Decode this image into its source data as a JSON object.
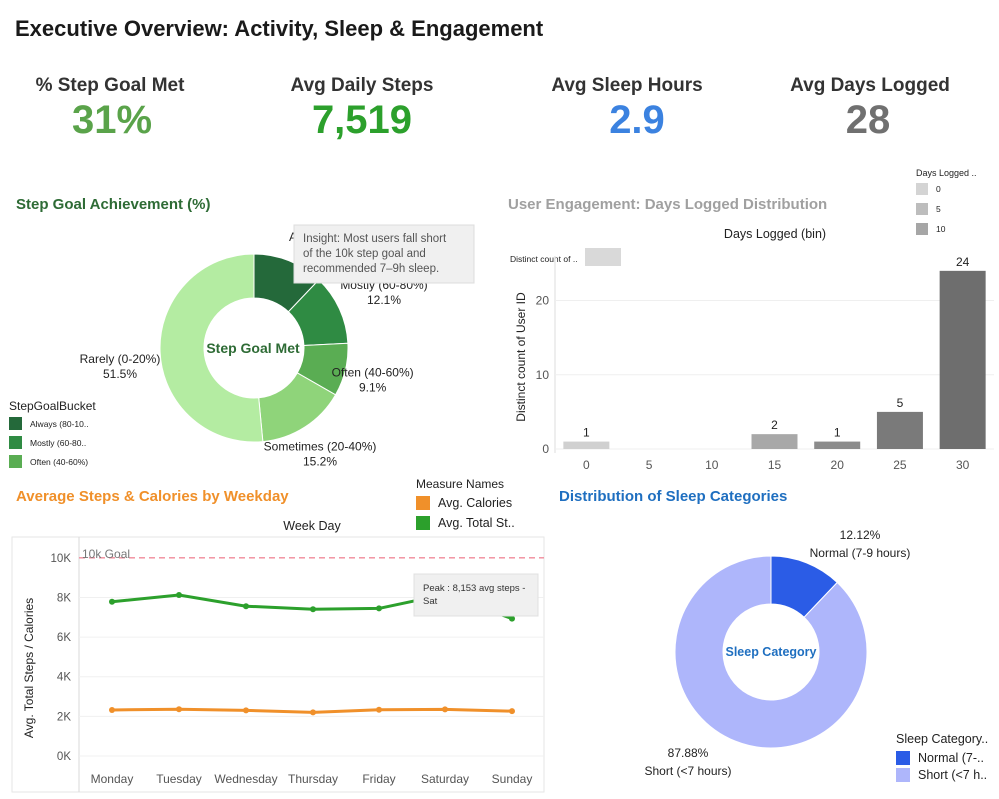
{
  "title": "Executive Overview: Activity, Sleep & Engagement",
  "kpis": [
    {
      "label": "% Step Goal Met",
      "value": "31%",
      "color": "#5aa34a"
    },
    {
      "label": "Avg Daily Steps",
      "value": "7,519",
      "color": "#2ca02c"
    },
    {
      "label": "Avg Sleep Hours",
      "value": "2.9",
      "color": "#3b82e0"
    },
    {
      "label": "Avg Days Logged",
      "value": "28",
      "color": "#707070"
    }
  ],
  "colors": {
    "green_title": "#2e6b35",
    "orange_title": "#f0902a",
    "blue_title": "#1f6fc0",
    "grey_title": "#a0a0a0"
  },
  "step_goal": {
    "title": "Step Goal Achievement (%)",
    "center_label": "Step Goal Met",
    "insight": "Insight: Most users fall short of the 10k step goal and recommended 7–9h sleep.",
    "hidden_label": "A",
    "legend_title": "StepGoalBucket",
    "legend_items": [
      {
        "label": "Always (80-10..",
        "color": "#24693a"
      },
      {
        "label": "Mostly (60-80..",
        "color": "#2f8b43"
      },
      {
        "label": "Often (40-60%)",
        "color": "#5aad53"
      }
    ]
  },
  "engagement": {
    "title": "User Engagement: Days Logged Distribution",
    "x_title": "Days Logged (bin)",
    "y_title": "Distinct count of User ID",
    "measure_chip": "Distinct count of ..",
    "legend_title": "Days Logged ..",
    "legend_items": [
      {
        "label": "0",
        "color": "#d4d4d4"
      },
      {
        "label": "5",
        "color": "#bdbdbd"
      },
      {
        "label": "10",
        "color": "#a6a6a6"
      }
    ]
  },
  "weekday": {
    "title": "Average Steps & Calories by Weekday",
    "header": "Week Day",
    "y_title": "Avg. Total Steps / Calories",
    "goal_label": "10k Goal",
    "peak_note": "Peak : 8,153 avg steps - Sat",
    "legend_title": "Measure Names",
    "legend_items": [
      {
        "label": "Avg. Calories",
        "color": "#f0902a"
      },
      {
        "label": "Avg. Total St..",
        "color": "#2ca02c"
      }
    ]
  },
  "sleep": {
    "title": "Distribution of Sleep Categories",
    "center_label": "Sleep Category",
    "legend_title": "Sleep Category..",
    "legend_items": [
      {
        "label": "Normal (7-..",
        "color": "#2b5ce6"
      },
      {
        "label": "Short (<7 h..",
        "color": "#aeb6fb"
      }
    ]
  },
  "chart_data": [
    {
      "type": "pie",
      "title": "Step Goal Achievement (%)",
      "labels": [
        "Always (80-100%)",
        "Mostly (60-80%)",
        "Often (40-60%)",
        "Sometimes (20-40%)",
        "Rarely (0-20%)"
      ],
      "display_labels": [
        "",
        "Mostly (60-80%)",
        "Often (40-60%)",
        "Sometimes (20-40%)",
        "Rarely (0-20%)"
      ],
      "values": [
        12.1,
        12.1,
        9.1,
        15.2,
        51.5
      ],
      "value_labels": [
        "",
        "12.1%",
        "9.1%",
        "15.2%",
        "51.5%"
      ],
      "colors": [
        "#24693a",
        "#2f8b43",
        "#5aad53",
        "#8fd47a",
        "#b4eca2"
      ]
    },
    {
      "type": "bar",
      "title": "User Engagement: Days Logged Distribution",
      "xlabel": "Days Logged (bin)",
      "ylabel": "Distinct count of User ID",
      "x": [
        0,
        20,
        15,
        25,
        30
      ],
      "values": [
        1,
        1,
        2,
        5,
        24
      ],
      "colors": [
        "#d0d0d0",
        "#8c8c8c",
        "#a8a8a8",
        "#7a7a7a",
        "#6e6e6e"
      ],
      "xticks": [
        0,
        5,
        10,
        15,
        20,
        25,
        30
      ],
      "yticks": [
        0,
        10,
        20
      ],
      "xlim": [
        -2.5,
        32.5
      ],
      "ylim": [
        0,
        26
      ]
    },
    {
      "type": "line",
      "title": "Average Steps & Calories by Weekday",
      "ylabel": "Avg. Total Steps / Calories",
      "categories": [
        "Monday",
        "Tuesday",
        "Wednesday",
        "Thursday",
        "Friday",
        "Saturday",
        "Sunday"
      ],
      "series": [
        {
          "name": "Avg. Total St..",
          "color": "#2ca02c",
          "values": [
            7781,
            8125,
            7559,
            7406,
            7448,
            8153,
            6933
          ]
        },
        {
          "name": "Avg. Calories",
          "color": "#f0902a",
          "values": [
            2324,
            2356,
            2302,
            2200,
            2332,
            2355,
            2263
          ]
        }
      ],
      "yticks": [
        0,
        2000,
        4000,
        6000,
        8000,
        10000
      ],
      "ytick_labels": [
        "0K",
        "2K",
        "4K",
        "6K",
        "8K",
        "10K"
      ],
      "goal": 10000,
      "ylim": [
        0,
        11000
      ]
    },
    {
      "type": "pie",
      "title": "Distribution of Sleep Categories",
      "labels": [
        "Normal (7-9 hours)",
        "Short (<7 hours)"
      ],
      "values": [
        12.12,
        87.88
      ],
      "value_labels": [
        "12.12%",
        "87.88%"
      ],
      "colors": [
        "#2b5ce6",
        "#aeb6fb"
      ]
    }
  ]
}
